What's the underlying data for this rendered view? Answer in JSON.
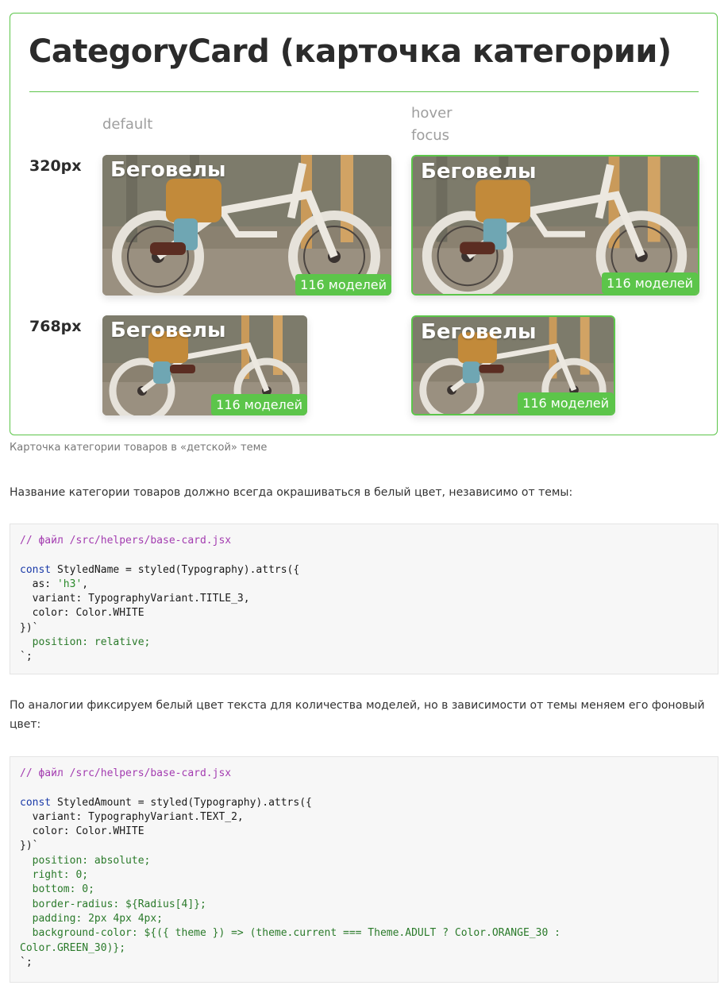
{
  "showcase": {
    "title": "CategoryCard (карточка категории)",
    "state_default": "default",
    "state_hover": "hover",
    "state_focus": "focus",
    "size_small": "320px",
    "size_large": "768px",
    "card": {
      "name": "Беговелы",
      "amount": "116 моделей"
    }
  },
  "caption": "Карточка категории товаров в «детской» теме",
  "para1": "Название категории товаров должно всегда окрашиваться в белый цвет, независимо от темы:",
  "code1": {
    "comment": "// файл /src/helpers/base-card.jsx",
    "line1_kw": "const",
    "line1_rest": " StyledName = styled(Typography).attrs({",
    "line2_a": "  as: ",
    "line2_str": "'h3'",
    "line2_b": ",",
    "line3": "  variant: TypographyVariant.TITLE_3,",
    "line4": "  color: Color.WHITE",
    "line5": "})`",
    "line6": "  position: relative;",
    "line7": "`;"
  },
  "para2": "По аналогии фиксируем белый цвет текста для количества моделей, но в зависимости от темы меняем его фоновый цвет:",
  "code2": {
    "comment": "// файл /src/helpers/base-card.jsx",
    "line1_kw": "const",
    "line1_rest": " StyledAmount = styled(Typography).attrs({",
    "line2": "  variant: TypographyVariant.TEXT_2,",
    "line3": "  color: Color.WHITE",
    "line4": "})`",
    "line5": "  position: absolute;",
    "line6": "  right: 0;",
    "line7": "  bottom: 0;",
    "line8": "  border-radius: ${Radius[4]};",
    "line9": "  padding: 2px 4px 4px;",
    "line10": "  background-color: ${({ theme }) => (theme.current === Theme.ADULT ? Color.ORANGE_30 :",
    "line11": "Color.GREEN_30)};",
    "line12": "`;"
  },
  "colors": {
    "accent_green": "#5cc54a",
    "code_comment": "#a33cb0",
    "code_keyword": "#1a3aa8",
    "code_string": "#2a8a2a"
  }
}
